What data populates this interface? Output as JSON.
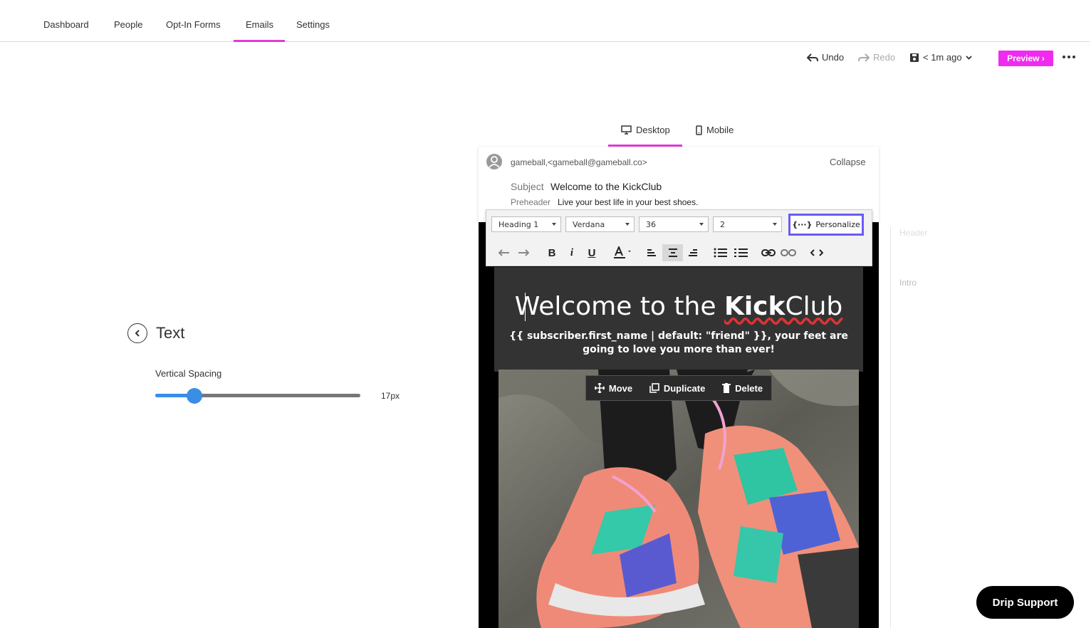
{
  "nav": {
    "items": [
      "Dashboard",
      "People",
      "Opt-In Forms",
      "Emails",
      "Settings"
    ],
    "active": "Emails"
  },
  "toolbar": {
    "undo": "Undo",
    "redo": "Redo",
    "saved": "< 1m ago",
    "preview": "Preview ›"
  },
  "view_tabs": {
    "desktop": "Desktop",
    "mobile": "Mobile",
    "active": "Desktop"
  },
  "panel": {
    "title": "Text",
    "vertical_spacing_label": "Vertical Spacing",
    "vertical_spacing_value": "17px",
    "vertical_spacing_fraction": 0.19
  },
  "email": {
    "from": "gameball,<gameball@gameball.co>",
    "collapse": "Collapse",
    "subject_label": "Subject",
    "subject": "Welcome to the KickClub",
    "preheader_label": "Preheader",
    "preheader": "Live your best life in your best shoes.",
    "hero_title_pre": "Welcome to the ",
    "hero_title_bold": "Kick",
    "hero_title_post": "Club",
    "hero_sub": "{{ subscriber.first_name | default: \"friend\" }}, your feet are going to love you more than ever!"
  },
  "editor": {
    "block_format": "Heading 1",
    "font": "Verdana",
    "size": "36",
    "line_height": "2",
    "personalize": "Personalize"
  },
  "image_actions": {
    "move": "Move",
    "duplicate": "Duplicate",
    "delete": "Delete"
  },
  "outline": [
    "Header",
    "Intro"
  ],
  "support": "Drip Support",
  "colors": {
    "accent": "#e23bd9",
    "preview": "#f02bef",
    "slider": "#3a8ee6",
    "personalize_border": "#6a5cf5"
  }
}
